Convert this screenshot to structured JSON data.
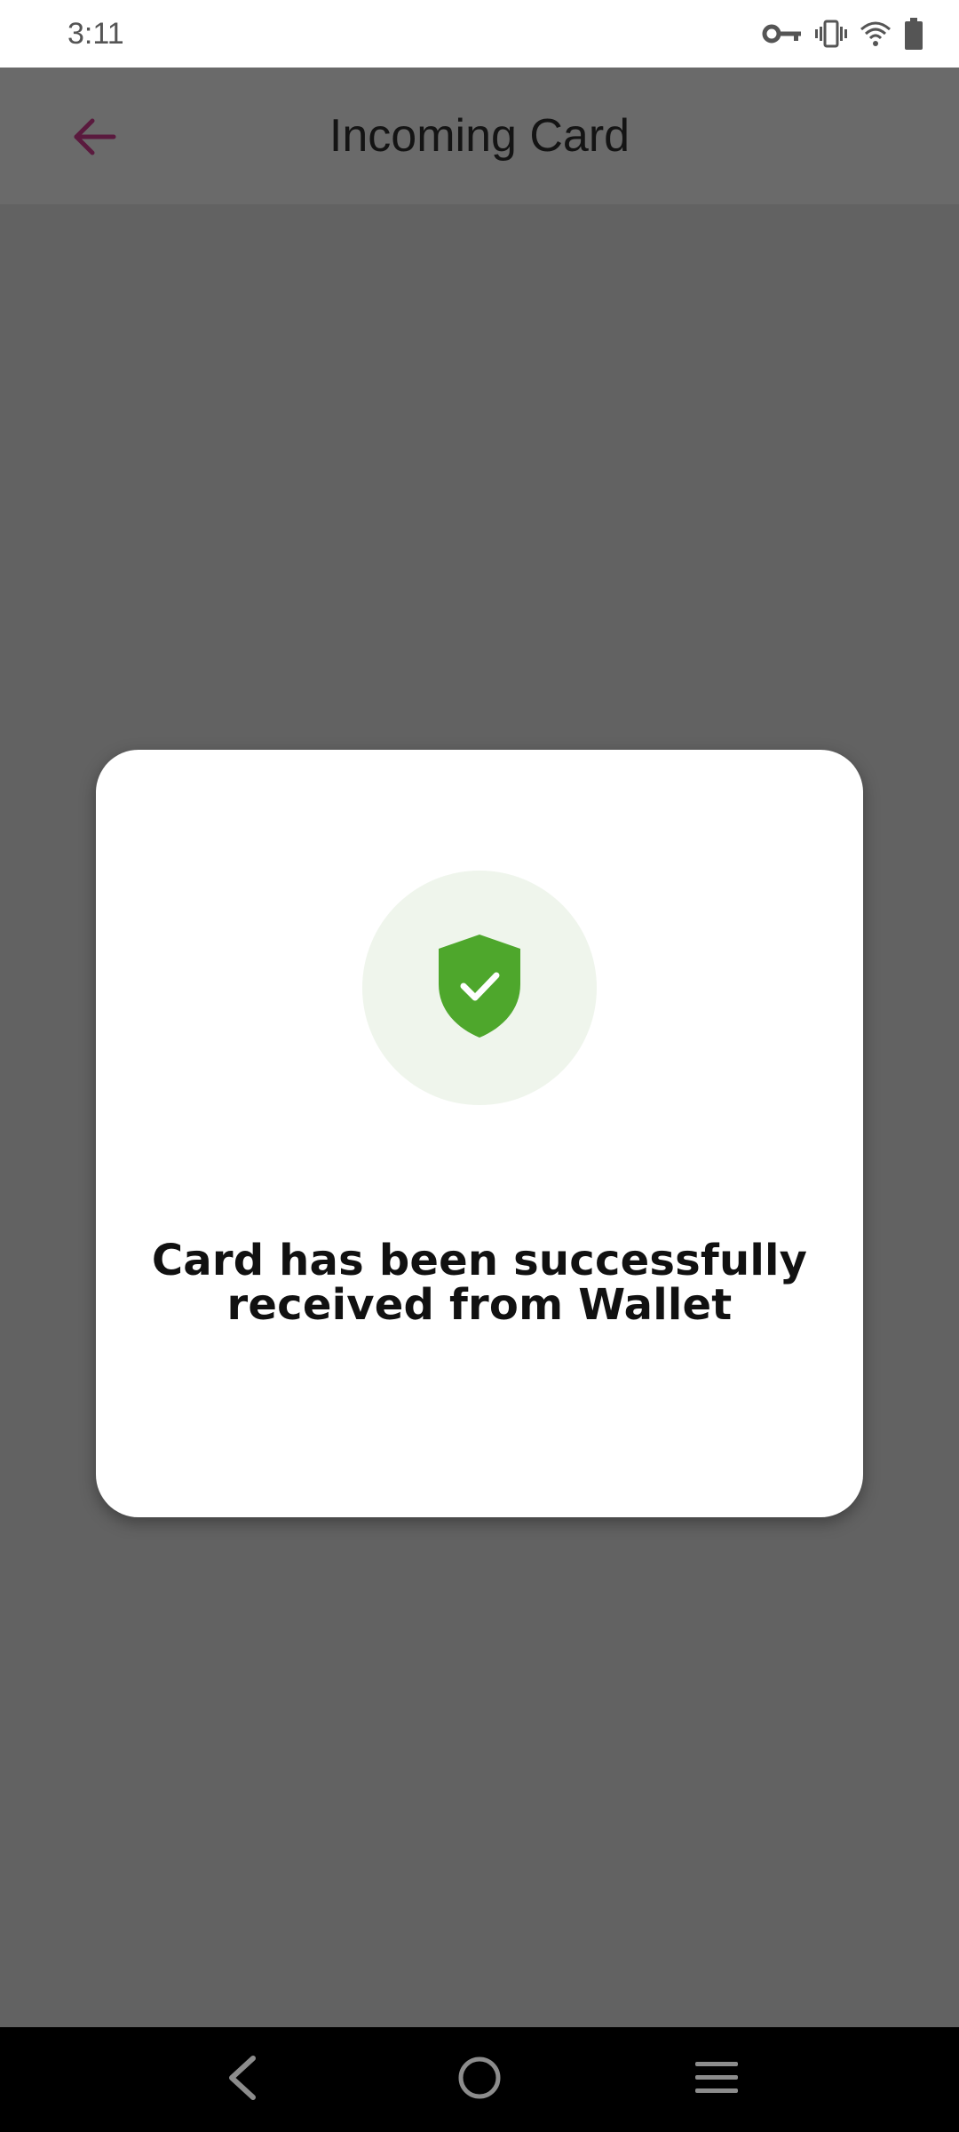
{
  "status_bar": {
    "time": "3:11",
    "icons": [
      "key-icon",
      "vibrate-icon",
      "wifi-icon",
      "battery-icon"
    ]
  },
  "app_bar": {
    "title": "Incoming Card",
    "back_icon": "arrow-back-icon",
    "back_color": "#5a1a3e"
  },
  "dialog": {
    "icon": "shield-check-icon",
    "icon_color": "#4ea72c",
    "icon_bg": "#eff5ec",
    "message_line1": "Card has been successfully",
    "message_line2": "received from Wallet"
  },
  "nav_bar": {
    "buttons": [
      "back-nav-icon",
      "home-nav-icon",
      "recents-nav-icon"
    ]
  }
}
